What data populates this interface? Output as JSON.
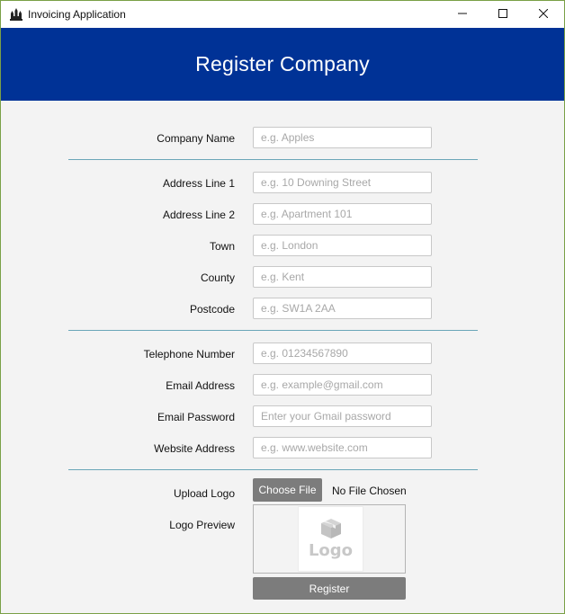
{
  "window": {
    "title": "Invoicing Application"
  },
  "banner": {
    "title": "Register Company"
  },
  "form": {
    "company_name": {
      "label": "Company Name",
      "placeholder": "e.g. Apples",
      "value": ""
    },
    "address_line_1": {
      "label": "Address Line 1",
      "placeholder": "e.g. 10 Downing Street",
      "value": ""
    },
    "address_line_2": {
      "label": "Address Line 2",
      "placeholder": "e.g. Apartment 101",
      "value": ""
    },
    "town": {
      "label": "Town",
      "placeholder": "e.g. London",
      "value": ""
    },
    "county": {
      "label": "County",
      "placeholder": "e.g. Kent",
      "value": ""
    },
    "postcode": {
      "label": "Postcode",
      "placeholder": "e.g. SW1A 2AA",
      "value": ""
    },
    "telephone_number": {
      "label": "Telephone Number",
      "placeholder": "e.g. 01234567890",
      "value": ""
    },
    "email_address": {
      "label": "Email Address",
      "placeholder": "e.g. example@gmail.com",
      "value": ""
    },
    "email_password": {
      "label": "Email Password",
      "placeholder": "Enter your Gmail password",
      "value": ""
    },
    "website_address": {
      "label": "Website Address",
      "placeholder": "e.g. www.website.com",
      "value": ""
    }
  },
  "logo": {
    "upload_label": "Upload Logo",
    "choose_button": "Choose File",
    "file_status": "No File Chosen",
    "preview_label": "Logo Preview",
    "placeholder_text": "Logo"
  },
  "actions": {
    "register_button": "Register"
  },
  "colors": {
    "banner": "#003296",
    "button": "#7c7c7c",
    "divider": "#6aa6b8",
    "window_border": "#7aa046"
  },
  "icons": {
    "app": "castle-icon",
    "minimize": "minimize-icon",
    "maximize": "maximize-icon",
    "close": "close-icon",
    "logo_placeholder": "box-icon"
  }
}
